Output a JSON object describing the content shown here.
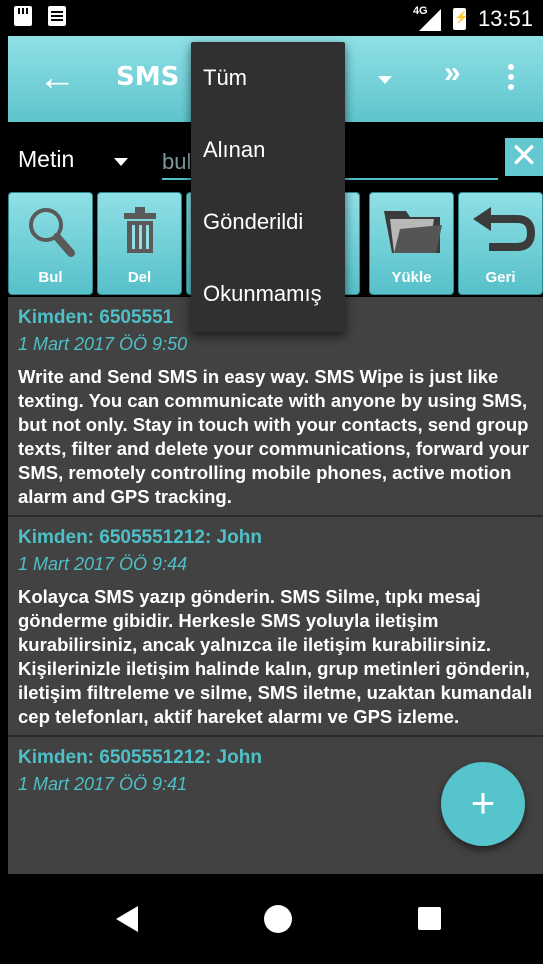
{
  "status_bar": {
    "network": "4G",
    "time": "13:51"
  },
  "app_bar": {
    "title": "SMS"
  },
  "search": {
    "type": "Metin",
    "placeholder": "bul"
  },
  "toolbar": [
    {
      "label": "Bul",
      "icon": "search-icon"
    },
    {
      "label": "Del",
      "icon": "trash-icon"
    },
    {
      "label": "",
      "icon": "hidden"
    },
    {
      "label": "",
      "icon": "hidden"
    },
    {
      "label": "Yükle",
      "icon": "folder-icon"
    },
    {
      "label": "Geri",
      "icon": "undo-icon"
    }
  ],
  "menu": {
    "items": [
      "Tüm",
      "Alınan",
      "Gönderildi",
      "Okunmamış"
    ]
  },
  "messages": [
    {
      "from": "Kimden:  6505551",
      "date": "1 Mart 2017 ÖÖ 9:50",
      "body": "Write and Send SMS in easy way. SMS Wipe is just like texting. You can communicate with anyone by using SMS, but not only. Stay in touch with your contacts, send group texts, filter and delete your communications, forward your SMS, remotely controlling mobile phones, active motion alarm and GPS tracking."
    },
    {
      "from": "Kimden:  6505551212: John",
      "date": "1 Mart 2017 ÖÖ 9:44",
      "body": "Kolayca SMS yazıp gönderin. SMS Silme, tıpkı mesaj gönderme gibidir. Herkesle SMS yoluyla iletişim kurabilirsiniz, ancak yalnızca ile iletişim kurabilirsiniz. Kişilerinizle iletişim halinde kalın, grup metinleri gönderin, iletişim filtreleme ve silme, SMS iletme, uzaktan kumandalı cep telefonları, aktif hareket alarmı ve GPS izleme."
    },
    {
      "from": "Kimden:  6505551212: John",
      "date": "1 Mart 2017 ÖÖ 9:41",
      "body": ""
    }
  ],
  "fab": {
    "label": "+"
  },
  "colors": {
    "accent": "#5fc4cc",
    "list_bg": "#424242",
    "menu_bg": "#303030",
    "link": "#4ec0c8"
  }
}
